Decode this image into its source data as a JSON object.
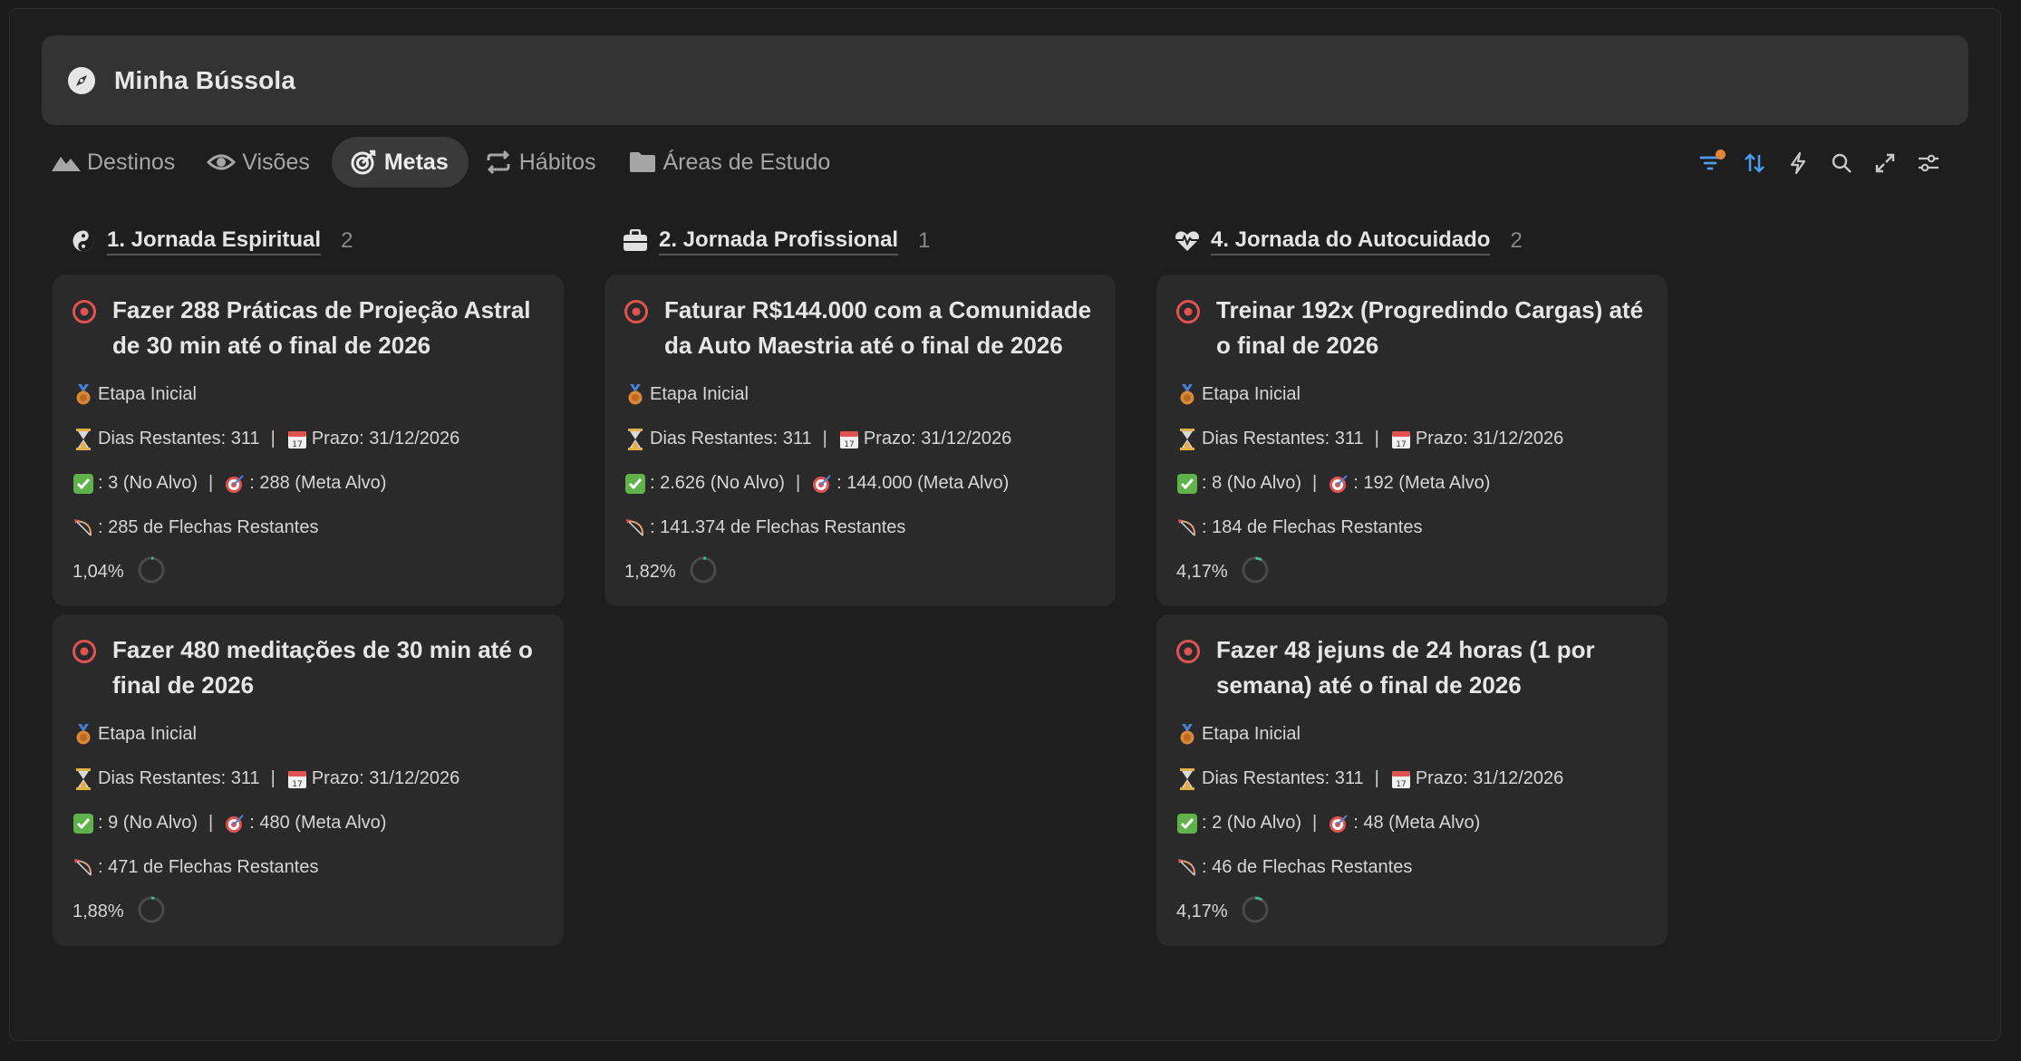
{
  "header": {
    "title": "Minha Bússola",
    "icon": "compass-icon"
  },
  "tabs": [
    {
      "label": "Destinos",
      "icon": "mountain-icon",
      "active": false
    },
    {
      "label": "Visões",
      "icon": "eye-icon",
      "active": false
    },
    {
      "label": "Metas",
      "icon": "target-icon",
      "active": true
    },
    {
      "label": "Hábitos",
      "icon": "repeat-icon",
      "active": false
    },
    {
      "label": "Áreas de Estudo",
      "icon": "folder-icon",
      "active": false
    }
  ],
  "toolbar": [
    "filter-icon",
    "sort-icon",
    "lightning-icon",
    "search-icon",
    "expand-icon",
    "settings-sliders-icon"
  ],
  "colors": {
    "accent": "#4a9eed",
    "target_red": "#e05353",
    "notification": "#e8843a",
    "progress": "#3fb68b"
  },
  "columns": [
    {
      "title": "1. Jornada Espiritual",
      "count": "2",
      "icon": "yin-yang-icon",
      "cards": [
        {
          "title": "Fazer 288 Práticas de Projeção Astral de 30 min até o final de 2026",
          "stage": "Etapa Inicial",
          "days": "Dias Restantes: 311",
          "deadline": "Prazo: 31/12/2026",
          "done": ": 3 (No Alvo)",
          "goal": ": 288 (Meta Alvo)",
          "remaining": ": 285 de Flechas Restantes",
          "percent": "1,04%",
          "progress": 0.0104
        },
        {
          "title": "Fazer 480 meditações de 30 min até o final de 2026",
          "stage": "Etapa Inicial",
          "days": "Dias Restantes: 311",
          "deadline": "Prazo: 31/12/2026",
          "done": ": 9 (No Alvo)",
          "goal": ": 480 (Meta Alvo)",
          "remaining": ": 471 de Flechas Restantes",
          "percent": "1,88%",
          "progress": 0.0188
        }
      ]
    },
    {
      "title": "2. Jornada Profissional",
      "count": "1",
      "icon": "briefcase-icon",
      "cards": [
        {
          "title": "Faturar R$144.000 com a Comunidade da Auto Maestria até o final de 2026",
          "stage": "Etapa Inicial",
          "days": "Dias Restantes: 311",
          "deadline": "Prazo: 31/12/2026",
          "done": ": 2.626 (No Alvo)",
          "goal": ": 144.000 (Meta Alvo)",
          "remaining": ": 141.374 de Flechas Restantes",
          "percent": "1,82%",
          "progress": 0.0182
        }
      ]
    },
    {
      "title": "4. Jornada do Autocuidado",
      "count": "2",
      "icon": "heart-pulse-icon",
      "cards": [
        {
          "title": "Treinar 192x (Progredindo Cargas) até o final de 2026",
          "stage": "Etapa Inicial",
          "days": "Dias Restantes: 311",
          "deadline": "Prazo: 31/12/2026",
          "done": ": 8 (No Alvo)",
          "goal": ": 192 (Meta Alvo)",
          "remaining": ": 184 de Flechas Restantes",
          "percent": "4,17%",
          "progress": 0.0417
        },
        {
          "title": "Fazer 48 jejuns de 24 horas (1 por semana) até o final de 2026",
          "stage": "Etapa Inicial",
          "days": "Dias Restantes: 311",
          "deadline": "Prazo: 31/12/2026",
          "done": ": 2 (No Alvo)",
          "goal": ": 48 (Meta Alvo)",
          "remaining": ": 46 de Flechas Restantes",
          "percent": "4,17%",
          "progress": 0.0417
        }
      ]
    }
  ]
}
